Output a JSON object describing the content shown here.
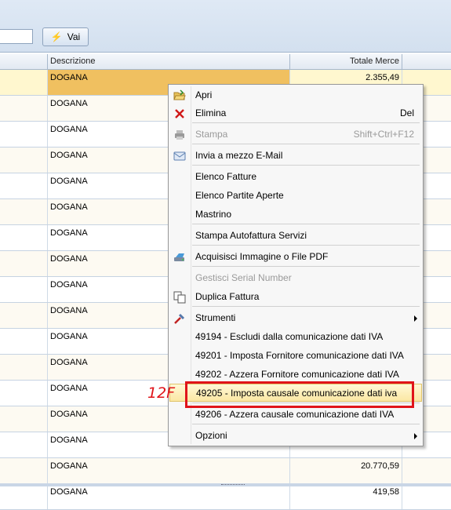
{
  "toolbar": {
    "vai_label": "Vai"
  },
  "grid": {
    "columns": [
      "Descrizione",
      "Totale Merce"
    ],
    "rows": [
      {
        "descrizione": "DOGANA",
        "totale": "2.355,49"
      },
      {
        "descrizione": "DOGANA",
        "totale": ""
      },
      {
        "descrizione": "DOGANA",
        "totale": ""
      },
      {
        "descrizione": "DOGANA",
        "totale": ""
      },
      {
        "descrizione": "DOGANA",
        "totale": ""
      },
      {
        "descrizione": "DOGANA",
        "totale": ""
      },
      {
        "descrizione": "DOGANA",
        "totale": ""
      },
      {
        "descrizione": "DOGANA",
        "totale": ""
      },
      {
        "descrizione": "DOGANA",
        "totale": ""
      },
      {
        "descrizione": "DOGANA",
        "totale": ""
      },
      {
        "descrizione": "DOGANA",
        "totale": ""
      },
      {
        "descrizione": "DOGANA",
        "totale": ""
      },
      {
        "descrizione": "DOGANA",
        "totale": ""
      },
      {
        "descrizione": "DOGANA",
        "totale": ""
      },
      {
        "descrizione": "DOGANA",
        "totale": ""
      },
      {
        "descrizione": "DOGANA",
        "totale": "20.770,59"
      },
      {
        "descrizione": "DOGANA",
        "totale": "419,58"
      }
    ]
  },
  "context_menu": {
    "items": [
      {
        "label": "Apri",
        "icon": "folder-open-icon"
      },
      {
        "label": "Elimina",
        "shortcut": "Del",
        "icon": "delete-x-icon"
      },
      {
        "label": "Stampa",
        "shortcut": "Shift+Ctrl+F12",
        "icon": "printer-icon",
        "disabled": true
      },
      {
        "label": "Invia a mezzo E-Mail",
        "icon": "email-icon"
      },
      {
        "label": "Elenco Fatture"
      },
      {
        "label": "Elenco Partite Aperte"
      },
      {
        "label": "Mastrino"
      },
      {
        "label": "Stampa Autofattura Servizi"
      },
      {
        "label": "Acquisisci Immagine o File PDF",
        "icon": "scanner-icon"
      },
      {
        "label": "Gestisci Serial Number",
        "disabled": true
      },
      {
        "label": "Duplica Fattura",
        "icon": "duplicate-icon"
      },
      {
        "label": "Strumenti",
        "icon": "tools-icon",
        "submenu": true
      },
      {
        "label": "49194 - Escludi dalla comunicazione dati IVA"
      },
      {
        "label": "49201 - Imposta Fornitore comunicazione dati IVA"
      },
      {
        "label": "49202 - Azzera Fornitore comunicazione dati IVA"
      },
      {
        "label": "49205 - Imposta causale comunicazione dati iva",
        "highlighted": true
      },
      {
        "label": "49206 - Azzera causale comunicazione dati IVA"
      },
      {
        "label": "Opzioni",
        "submenu": true
      }
    ]
  },
  "annotation": {
    "tag": "12F",
    "color": "#e0141a"
  },
  "colors": {
    "selected_cell": "#f0c060",
    "highlight_box": "#e0141a"
  }
}
